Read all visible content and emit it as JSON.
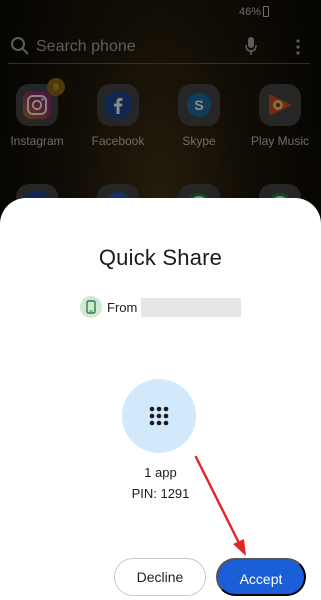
{
  "status_bar": {
    "battery": "46%"
  },
  "search": {
    "placeholder": "Search phone"
  },
  "apps_row1": [
    {
      "label": "Instagram",
      "icon": "instagram-icon",
      "badge": "9"
    },
    {
      "label": "Facebook",
      "icon": "facebook-icon"
    },
    {
      "label": "Skype",
      "icon": "skype-icon"
    },
    {
      "label": "Play Music",
      "icon": "play-music-icon"
    }
  ],
  "apps_row2": [
    {
      "label": "",
      "icon": "facebook-icon"
    },
    {
      "label": "",
      "icon": "messenger-icon"
    },
    {
      "label": "",
      "icon": "whatsapp-icon"
    },
    {
      "label": "",
      "icon": "whatsapp-icon"
    }
  ],
  "sheet": {
    "title": "Quick Share",
    "from_label": "From",
    "content_count": "1 app",
    "pin": "PIN: 1291",
    "decline_label": "Decline",
    "accept_label": "Accept"
  },
  "colors": {
    "accent": "#1a5ed8",
    "apps_circle": "#d2e8fb",
    "device_chip": "#cfe9d5",
    "annotation_arrow": "#e0262c"
  }
}
